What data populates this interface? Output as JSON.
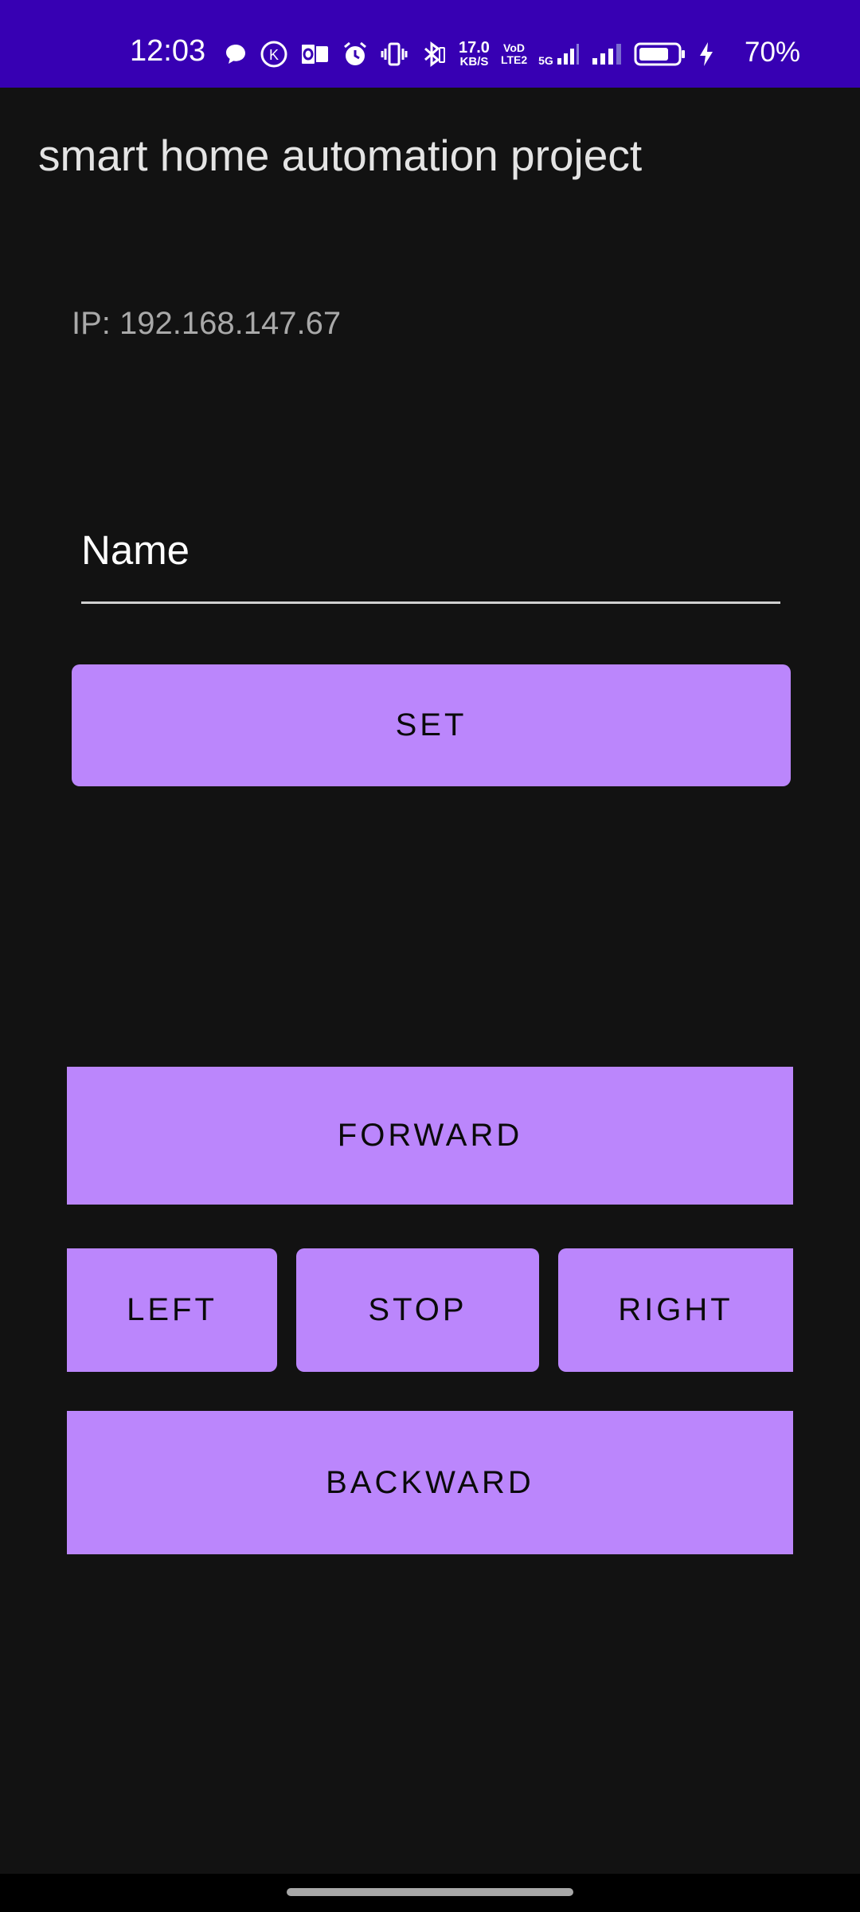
{
  "status_bar": {
    "time": "12:03",
    "net_speed_value": "17.0",
    "net_speed_unit": "KB/S",
    "volte_top": "VoD",
    "volte_bottom": "LTE2",
    "network_label": "5G",
    "battery_percent": "70%",
    "icons": [
      "chat-bubble-icon",
      "k-app-icon",
      "outlook-icon",
      "alarm-icon",
      "vibrate-icon",
      "bluetooth-icon",
      "signal-5g-icon",
      "signal-icon",
      "battery-icon",
      "charging-icon"
    ]
  },
  "app": {
    "title": "smart home automation project"
  },
  "main": {
    "ip_label": "IP: 192.168.147.67",
    "name_input": {
      "placeholder": "Name",
      "value": ""
    },
    "set_label": "SET"
  },
  "controls": {
    "forward_label": "FORWARD",
    "left_label": "LEFT",
    "stop_label": "STOP",
    "right_label": "RIGHT",
    "backward_label": "BACKWARD"
  },
  "colors": {
    "status_bar": "#3700b3",
    "background": "#121212",
    "button": "#bb86fc",
    "button_text": "#0a0a0a"
  }
}
